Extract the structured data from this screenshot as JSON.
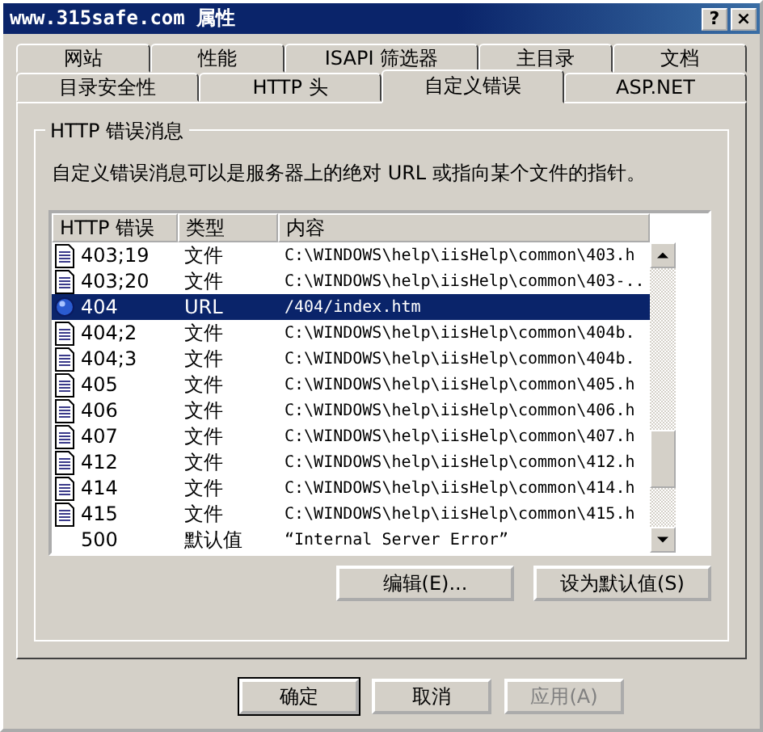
{
  "window": {
    "title": "www.315safe.com 属性"
  },
  "title_buttons": [
    "?",
    "×"
  ],
  "tab_rows": [
    [
      {
        "label": "网站",
        "selected": false
      },
      {
        "label": "性能",
        "selected": false
      },
      {
        "label": "ISAPI 筛选器",
        "selected": false
      },
      {
        "label": "主目录",
        "selected": false
      },
      {
        "label": "文档",
        "selected": false
      }
    ],
    [
      {
        "label": "目录安全性",
        "selected": false
      },
      {
        "label": "HTTP 头",
        "selected": false
      },
      {
        "label": "自定义错误",
        "selected": true
      },
      {
        "label": "ASP.NET",
        "selected": false
      }
    ]
  ],
  "group": {
    "title": "HTTP 错误消息",
    "description": "自定义错误消息可以是服务器上的绝对 URL 或指向某个文件的指针。"
  },
  "table": {
    "columns": [
      "HTTP 错误",
      "类型",
      "内容"
    ],
    "rows": [
      {
        "kind": "file",
        "error": "403;19",
        "type": "文件",
        "content": "C:\\WINDOWS\\help\\iisHelp\\common\\403.h",
        "selected": false
      },
      {
        "kind": "file",
        "error": "403;20",
        "type": "文件",
        "content": "C:\\WINDOWS\\help\\iisHelp\\common\\403-..",
        "selected": false
      },
      {
        "kind": "url",
        "error": "404",
        "type": "URL",
        "content": "/404/index.htm",
        "selected": true
      },
      {
        "kind": "file",
        "error": "404;2",
        "type": "文件",
        "content": "C:\\WINDOWS\\help\\iisHelp\\common\\404b.",
        "selected": false
      },
      {
        "kind": "file",
        "error": "404;3",
        "type": "文件",
        "content": "C:\\WINDOWS\\help\\iisHelp\\common\\404b.",
        "selected": false
      },
      {
        "kind": "file",
        "error": "405",
        "type": "文件",
        "content": "C:\\WINDOWS\\help\\iisHelp\\common\\405.h",
        "selected": false
      },
      {
        "kind": "file",
        "error": "406",
        "type": "文件",
        "content": "C:\\WINDOWS\\help\\iisHelp\\common\\406.h",
        "selected": false
      },
      {
        "kind": "file",
        "error": "407",
        "type": "文件",
        "content": "C:\\WINDOWS\\help\\iisHelp\\common\\407.h",
        "selected": false
      },
      {
        "kind": "file",
        "error": "412",
        "type": "文件",
        "content": "C:\\WINDOWS\\help\\iisHelp\\common\\412.h",
        "selected": false
      },
      {
        "kind": "file",
        "error": "414",
        "type": "文件",
        "content": "C:\\WINDOWS\\help\\iisHelp\\common\\414.h",
        "selected": false
      },
      {
        "kind": "file",
        "error": "415",
        "type": "文件",
        "content": "C:\\WINDOWS\\help\\iisHelp\\common\\415.h",
        "selected": false
      },
      {
        "kind": "default",
        "error": "500",
        "type": "默认值",
        "content": "“Internal Server Error”",
        "selected": false
      }
    ]
  },
  "actions": [
    {
      "label": "编辑(E)...",
      "disabled": false
    },
    {
      "label": "设为默认值(S)",
      "disabled": false
    }
  ],
  "buttons": [
    {
      "label": "确定",
      "disabled": false,
      "default": true
    },
    {
      "label": "取消",
      "disabled": false,
      "default": false
    },
    {
      "label": "应用(A)",
      "disabled": true,
      "default": false
    }
  ]
}
